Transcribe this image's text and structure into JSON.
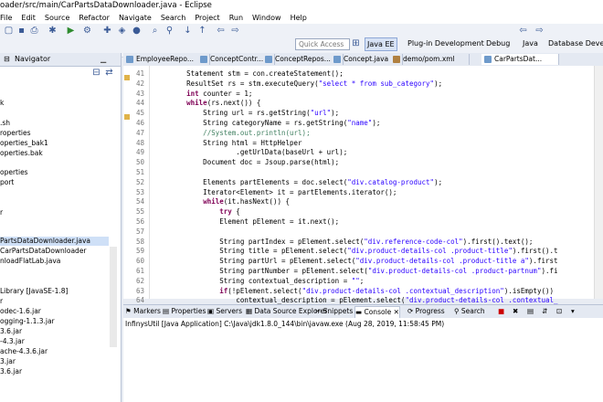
{
  "window": {
    "title": "oader/src/main/CarPartsDataDownloader.java - Eclipse"
  },
  "menu": [
    "File",
    "Edit",
    "Source",
    "Refactor",
    "Navigate",
    "Search",
    "Project",
    "Run",
    "Window",
    "Help"
  ],
  "quick_access": {
    "placeholder": "Quick Access"
  },
  "perspectives": [
    "Java EE",
    "Plug-in Development",
    "Debug",
    "Java",
    "Database Deve"
  ],
  "left_tabs": [
    "Navigator"
  ],
  "tree": [
    "k",
    "",
    ".sh",
    "roperties",
    "operties_bak1",
    "operties.bak",
    "",
    "operties",
    "port",
    "",
    "",
    "r",
    "",
    "",
    "PartsDataDownloader.java",
    "CarPartsDataDownloader",
    "nloadFlatLab.java",
    "",
    "",
    "",
    "",
    "Library [JavaSE-1.8]",
    "r",
    "odec-1.6.jar",
    "ogging-1.1.3.jar",
    "3.6.jar",
    "-4.3.jar",
    "ache-4.3.6.jar",
    "3.jar",
    "3.6.jar"
  ],
  "editor_tabs": [
    "EmployeeRepo...",
    "ConceptContr...",
    "ConceptRepos...",
    "Concept.java",
    "demo/pom.xml",
    "CarPartsDat..."
  ],
  "code": [
    {
      "n": "41",
      "t": "        Statement stm = con.createStatement();"
    },
    {
      "n": "42",
      "t": "        ResultSet rs = stm.executeQuery(\"select * from sub_category\");"
    },
    {
      "n": "43",
      "t": "        int counter = 1;"
    },
    {
      "n": "44",
      "t": "        while(rs.next()) {"
    },
    {
      "n": "45",
      "t": "            String url = rs.getString(\"url\");"
    },
    {
      "n": "46",
      "t": "            String categoryName = rs.getString(\"name\");"
    },
    {
      "n": "47",
      "t": "            //System.out.println(url);"
    },
    {
      "n": "48",
      "t": "            String html = HttpHelper"
    },
    {
      "n": "49",
      "t": "                    .getUrlData(baseUrl + url);"
    },
    {
      "n": "50",
      "t": "            Document doc = Jsoup.parse(html);"
    },
    {
      "n": "51",
      "t": ""
    },
    {
      "n": "52",
      "t": "            Elements partElements = doc.select(\"div.catalog-product\");"
    },
    {
      "n": "53",
      "t": "            Iterator<Element> it = partElements.iterator();"
    },
    {
      "n": "54",
      "t": "            while(it.hasNext()) {"
    },
    {
      "n": "55",
      "t": "                try {"
    },
    {
      "n": "56",
      "t": "                Element pElement = it.next();"
    },
    {
      "n": "57",
      "t": ""
    },
    {
      "n": "58",
      "t": "                String partIndex = pElement.select(\"div.reference-code-col\").first().text();"
    },
    {
      "n": "59",
      "t": "                String title = pElement.select(\"div.product-details-col .product-title\").first().t"
    },
    {
      "n": "60",
      "t": "                String partUrl = pElement.select(\"div.product-details-col .product-title a\").first"
    },
    {
      "n": "61",
      "t": "                String partNumber = pElement.select(\"div.product-details-col .product-partnum\").fi"
    },
    {
      "n": "62",
      "t": "                String contextual_description = \"\";"
    },
    {
      "n": "63",
      "t": "                if(!pElement.select(\"div.product-details-col .contextual_description\").isEmpty())"
    },
    {
      "n": "64",
      "t": "                    contextual_description = pElement.select(\"div.product-details-col .contextual_"
    }
  ],
  "bottom_tabs": [
    "Markers",
    "Properties",
    "Servers",
    "Data Source Explorer",
    "Snippets",
    "Console",
    "Progress",
    "Search"
  ],
  "console": {
    "status": "InfinysUtil [Java Application] C:\\Java\\jdk1.8.0_144\\bin\\javaw.exe (Aug 28, 2019, 11:58:45 PM)"
  },
  "colors": {
    "keyword": "#7f0055",
    "string": "#2a00ff",
    "comment": "#3f7f5f",
    "field": "#0000c0",
    "active_persp": "#d7e2f5"
  }
}
